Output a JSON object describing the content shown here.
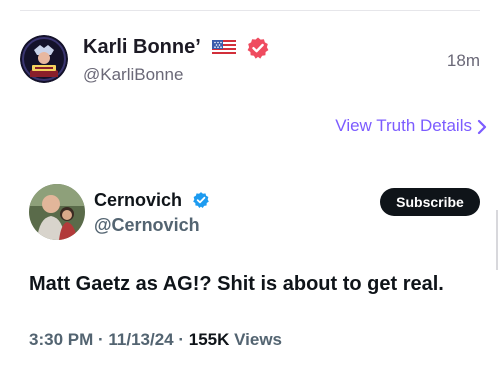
{
  "post": {
    "author_name": "Karli Bonne’",
    "author_handle": "@KarliBonne",
    "time": "18m",
    "details_link": "View Truth Details",
    "avatar_icon": "crest-avatar",
    "flag_icon": "us-flag-icon",
    "verified_icon": "red-verified-badge-icon"
  },
  "quoted": {
    "author_name": "Cernovich",
    "author_handle": "@Cernovich",
    "subscribe_label": "Subscribe",
    "text": "Matt Gaetz as AG!? Shit is about to get real.",
    "time": "3:30 PM",
    "date": "11/13/24",
    "views_count": "155K",
    "views_label": "Views",
    "avatar_icon": "photo-avatar",
    "verified_icon": "blue-verified-badge-icon"
  },
  "colors": {
    "link_purple": "#7c5cff",
    "verified_red": "#ef4b5f",
    "verified_blue": "#1d9bf0",
    "subscribe_bg": "#0f1419"
  }
}
